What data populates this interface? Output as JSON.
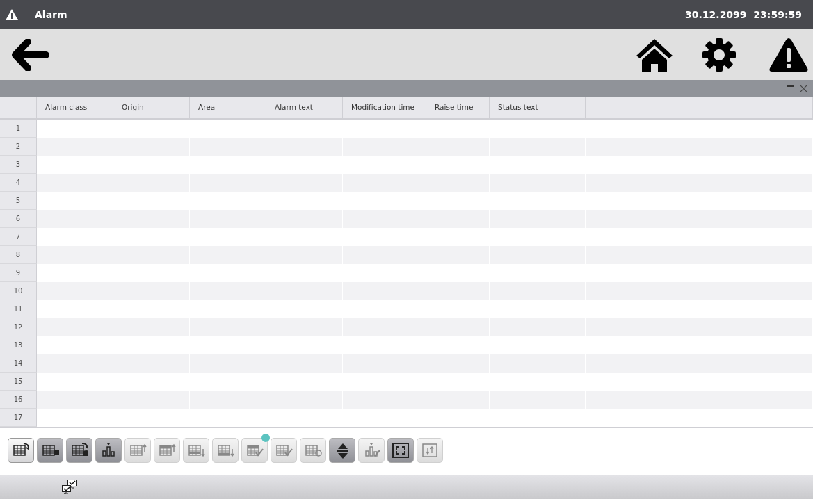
{
  "title_bar": {
    "title": "Alarm",
    "datetime": "30.12.2099  23:59:59"
  },
  "alarm_table": {
    "columns": [
      "Alarm class",
      "Origin",
      "Area",
      "Alarm text",
      "Modification time",
      "Raise time",
      "Status text"
    ],
    "rows": [
      {
        "number": "1"
      },
      {
        "number": "2"
      },
      {
        "number": "3"
      },
      {
        "number": "4"
      },
      {
        "number": "5"
      },
      {
        "number": "6"
      },
      {
        "number": "7"
      },
      {
        "number": "8"
      },
      {
        "number": "9"
      },
      {
        "number": "10"
      },
      {
        "number": "11"
      },
      {
        "number": "12"
      },
      {
        "number": "13"
      },
      {
        "number": "14"
      },
      {
        "number": "15"
      },
      {
        "number": "16"
      },
      {
        "number": "17"
      }
    ]
  },
  "toolbar": [
    {
      "selected": true,
      "disabled": false,
      "badge": false
    },
    {
      "selected": false,
      "disabled": false,
      "badge": false
    },
    {
      "selected": false,
      "disabled": false,
      "badge": false
    },
    {
      "selected": false,
      "disabled": false,
      "badge": false
    },
    {
      "selected": false,
      "disabled": true,
      "badge": false
    },
    {
      "selected": false,
      "disabled": true,
      "badge": false
    },
    {
      "selected": false,
      "disabled": true,
      "badge": false
    },
    {
      "selected": false,
      "disabled": true,
      "badge": false
    },
    {
      "selected": false,
      "disabled": true,
      "badge": true
    },
    {
      "selected": false,
      "disabled": true,
      "badge": false
    },
    {
      "selected": false,
      "disabled": true,
      "badge": false
    },
    {
      "selected": false,
      "disabled": false,
      "badge": false
    },
    {
      "selected": false,
      "disabled": true,
      "badge": false
    },
    {
      "selected": false,
      "disabled": false,
      "badge": false
    },
    {
      "selected": false,
      "disabled": true,
      "badge": false
    }
  ]
}
